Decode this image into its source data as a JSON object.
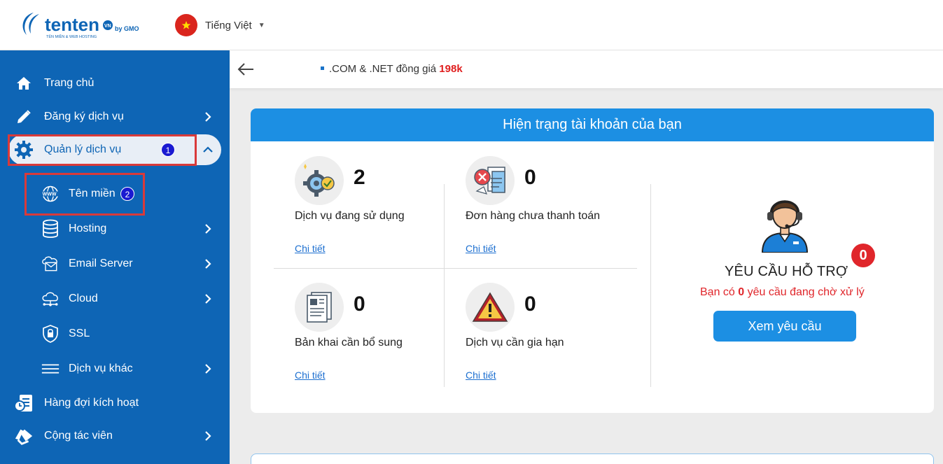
{
  "header": {
    "brand_name": "tenten",
    "brand_tag": "by GMO",
    "brand_tagline": "TÊN MIỀN & WEB HOSTING",
    "language": "Tiếng Việt"
  },
  "sidebar": {
    "items": [
      {
        "label": "Trang chủ",
        "icon": "home-icon"
      },
      {
        "label": "Đăng ký dịch vụ",
        "icon": "pencil-icon"
      },
      {
        "label": "Quản lý dịch vụ",
        "icon": "gear-icon",
        "badge": "1"
      },
      {
        "label": "Tên miền",
        "icon": "www-globe-icon",
        "badge": "2"
      },
      {
        "label": "Hosting",
        "icon": "database-icon"
      },
      {
        "label": "Email Server",
        "icon": "email-cloud-icon"
      },
      {
        "label": "Cloud",
        "icon": "cloud-icon"
      },
      {
        "label": "SSL",
        "icon": "shield-lock-icon"
      },
      {
        "label": "Dịch vụ khác",
        "icon": "menu-lines-icon"
      },
      {
        "label": "Hàng đợi kích hoạt",
        "icon": "queue-clock-icon"
      },
      {
        "label": "Cộng tác viên",
        "icon": "handshake-icon"
      }
    ]
  },
  "notice": {
    "text": ".COM & .NET đồng giá",
    "price": "198k"
  },
  "status": {
    "title": "Hiện trạng tài khoản của bạn",
    "link_label": "Chi tiết",
    "stats": [
      {
        "count": "2",
        "label": "Dịch vụ đang sử dụng",
        "icon": "gear-check-icon"
      },
      {
        "count": "0",
        "label": "Đơn hàng chưa thanh toán",
        "icon": "invoice-error-icon"
      },
      {
        "count": "0",
        "label": "Bản khai cần bổ sung",
        "icon": "document-icon"
      },
      {
        "count": "0",
        "label": "Dịch vụ cần gia hạn",
        "icon": "warning-icon"
      }
    ],
    "support": {
      "title": "YÊU CẦU HỖ TRỢ",
      "badge": "0",
      "sub_prefix": "Bạn có",
      "sub_count": "0",
      "sub_suffix": "yêu cầu đang chờ xử lý",
      "button": "Xem yêu cầu"
    }
  },
  "colors": {
    "sidebar": "#0e65b5",
    "accent": "#1c8fe3",
    "alert": "#e0262b"
  }
}
